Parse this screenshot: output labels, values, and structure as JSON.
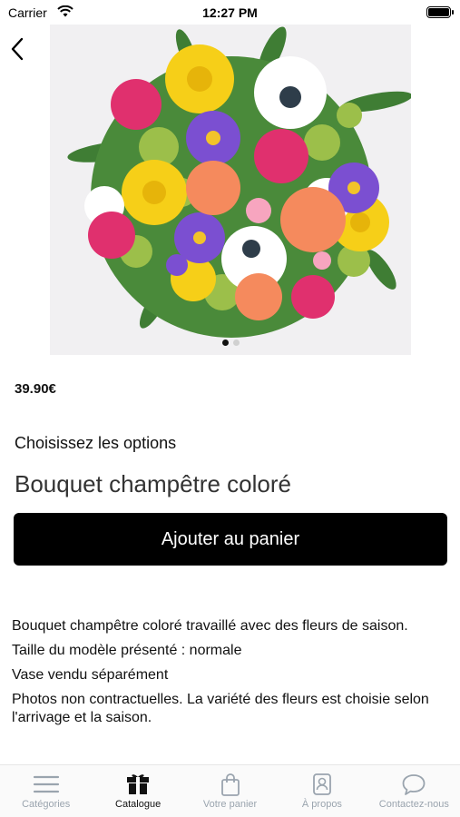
{
  "status_bar": {
    "carrier": "Carrier",
    "time": "12:27 PM"
  },
  "icons": {
    "back": "chevron-left-icon",
    "wifi": "wifi-icon",
    "battery": "battery-icon"
  },
  "gallery": {
    "current_page": 1,
    "page_count": 2
  },
  "product": {
    "price": "39.90€",
    "options_label": "Choisissez les options",
    "title": "Bouquet champêtre coloré",
    "add_to_cart_label": "Ajouter au panier",
    "description": [
      "Bouquet champêtre coloré travaillé avec des fleurs de saison.",
      "Taille du modèle présenté : normale",
      "Vase vendu séparément",
      "Photos non contractuelles. La variété des fleurs est choisie selon l'arrivage et la saison."
    ]
  },
  "tab_bar": {
    "active_index": 1,
    "tabs": [
      {
        "label": "Catégories",
        "icon": "menu-lines-icon"
      },
      {
        "label": "Catalogue",
        "icon": "gift-box-icon"
      },
      {
        "label": "Votre panier",
        "icon": "shopping-bag-icon"
      },
      {
        "label": "À propos",
        "icon": "contact-card-icon"
      },
      {
        "label": "Contactez-nous",
        "icon": "chat-bubble-icon"
      }
    ]
  },
  "colors": {
    "accent": "#000000",
    "tab_inactive": "#9aa4ae",
    "tab_active": "#111111"
  }
}
